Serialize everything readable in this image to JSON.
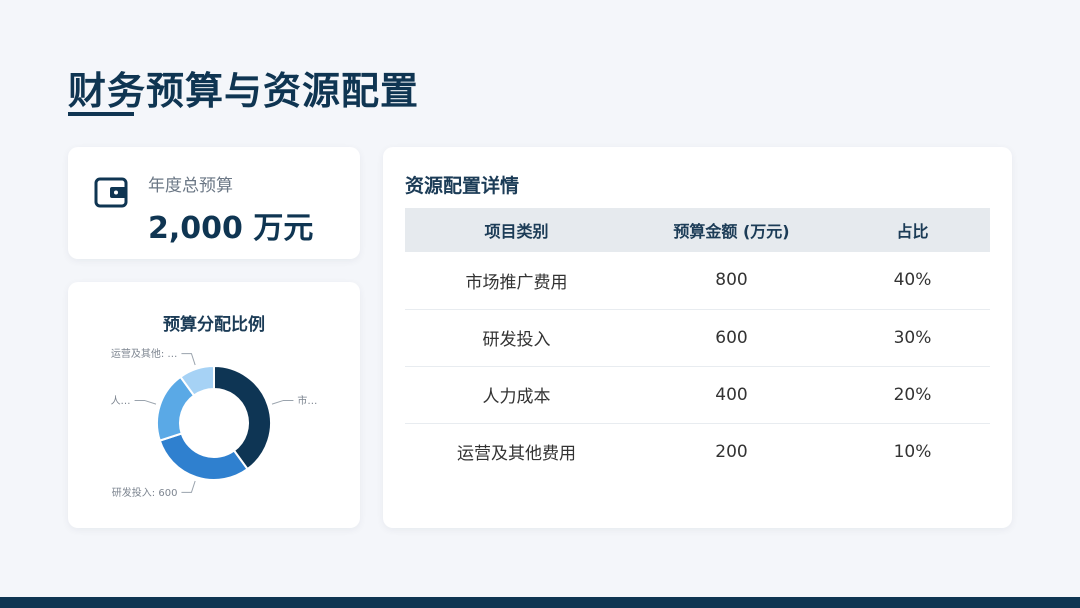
{
  "page": {
    "title": "财务预算与资源配置"
  },
  "budget": {
    "label": "年度总预算",
    "value": "2,000 万元",
    "icon": "wallet-icon"
  },
  "donut": {
    "title": "预算分配比例",
    "labels": [
      "市…",
      "研发投入: 600",
      "人…",
      "运营及其他: …"
    ]
  },
  "chart_data": {
    "type": "pie",
    "title": "预算分配比例",
    "categories": [
      "市场推广费用",
      "研发投入",
      "人力成本",
      "运营及其他费用"
    ],
    "values": [
      800,
      600,
      400,
      200
    ],
    "colors": [
      "#0e3554",
      "#2f80cf",
      "#5aa9e6",
      "#a6d2f5"
    ],
    "donut": true
  },
  "table": {
    "title": "资源配置详情",
    "headers": [
      "项目类别",
      "预算金额 (万元)",
      "占比"
    ],
    "rows": [
      [
        "市场推广费用",
        "800",
        "40%"
      ],
      [
        "研发投入",
        "600",
        "30%"
      ],
      [
        "人力成本",
        "400",
        "20%"
      ],
      [
        "运营及其他费用",
        "200",
        "10%"
      ]
    ]
  },
  "colors": {
    "primary": "#0f3552",
    "background": "#f4f6fa"
  }
}
